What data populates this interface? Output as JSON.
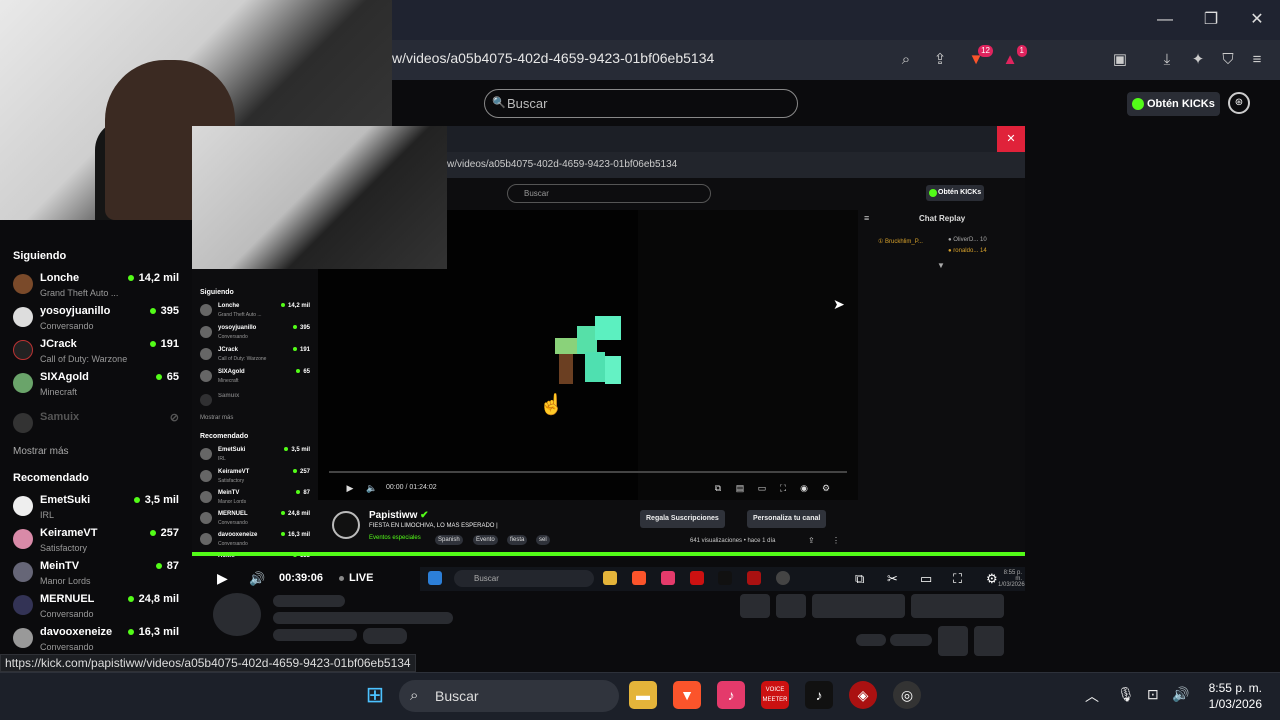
{
  "browser": {
    "url": "w/videos/a05b4075-402d-4659-9423-01bf06eb5134",
    "brave_badge": "12",
    "alert_badge": "1"
  },
  "kick": {
    "search_placeholder": "Buscar",
    "get_kicks_label": "Obtén KICKs"
  },
  "sidebar": {
    "following_title": "Siguiendo",
    "following": [
      {
        "name": "Lonche",
        "game": "Grand Theft Auto ...",
        "viewers": "14,2 mil"
      },
      {
        "name": "yosoyjuanillo",
        "game": "Conversando",
        "viewers": "395"
      },
      {
        "name": "JCrack",
        "game": "Call of Duty: Warzone",
        "viewers": "191"
      },
      {
        "name": "SIXAgold",
        "game": "Minecraft",
        "viewers": "65"
      },
      {
        "name": "Samuix",
        "game": "",
        "viewers": ""
      }
    ],
    "show_more": "Mostrar más",
    "recommended_title": "Recomendado",
    "recommended": [
      {
        "name": "EmetSuki",
        "game": "IRL",
        "viewers": "3,5 mil"
      },
      {
        "name": "KeirameVT",
        "game": "Satisfactory",
        "viewers": "257"
      },
      {
        "name": "MeinTV",
        "game": "Manor Lords",
        "viewers": "87"
      },
      {
        "name": "MERNUEL",
        "game": "Conversando",
        "viewers": "24,8 mil"
      },
      {
        "name": "davooxeneize",
        "game": "Conversando",
        "viewers": "16,3 mil"
      }
    ]
  },
  "inner": {
    "url": "w/videos/a05b4075-402d-4659-9423-01bf06eb5134",
    "search_placeholder": "Buscar",
    "get_kicks_label": "Obtén KICKs",
    "chat_replay": "Chat Replay",
    "chat_user1": "Bruckhlim_P...",
    "chat_user2": "OliverD...",
    "chat_user3": "ronaldo...",
    "chat_val1": "10",
    "chat_val2": "14",
    "video_time": "00:00 / 01:24:02",
    "sidebar_following": "Siguiendo",
    "sidebar_show_more": "Mostrar más",
    "sidebar_recommended": "Recomendado",
    "following": [
      {
        "name": "Lonche",
        "game": "Grand Theft Auto ...",
        "viewers": "14,2 mil"
      },
      {
        "name": "yosoyjuanillo",
        "game": "Conversando",
        "viewers": "395"
      },
      {
        "name": "JCrack",
        "game": "Call of Duty: Warzone",
        "viewers": "191"
      },
      {
        "name": "SIXAgold",
        "game": "Minecraft",
        "viewers": "65"
      },
      {
        "name": "Samuix",
        "game": "",
        "viewers": ""
      }
    ],
    "recommended": [
      {
        "name": "EmetSuki",
        "game": "IRL",
        "viewers": "3,5 mil"
      },
      {
        "name": "KeirameVT",
        "game": "Satisfactory",
        "viewers": "257"
      },
      {
        "name": "MeinTV",
        "game": "Manor Lords",
        "viewers": "87"
      },
      {
        "name": "MERNUEL",
        "game": "Conversando",
        "viewers": "24,8 mil"
      },
      {
        "name": "davooxeneize",
        "game": "Conversando",
        "viewers": "16,3 mil"
      },
      {
        "name": "Hoxhi",
        "game": "",
        "viewers": "133"
      }
    ],
    "streamer": "Papistiww",
    "stream_title": "FIESTA EN LIMOCHIVA, LO MAS ESPERADO |",
    "category": "Eventos especiales",
    "tags": [
      "Spanish",
      "Evento",
      "fiesta",
      "sel"
    ],
    "subs_button": "Regala Suscripciones",
    "customize_button": "Personaliza tu canal",
    "views": "641 visualizaciones • hace 1 día",
    "taskbar_search": "Buscar",
    "clock_time": "8:55 p. m.",
    "clock_date": "1/03/2026"
  },
  "player": {
    "time": "00:39:06",
    "live": "LIVE"
  },
  "status_url": "https://kick.com/papistiww/videos/a05b4075-402d-4659-9423-01bf06eb5134",
  "taskbar": {
    "search_placeholder": "Buscar",
    "voice_label": "VOICE MEETER",
    "time": "8:55 p. m.",
    "date": "1/03/2026"
  }
}
